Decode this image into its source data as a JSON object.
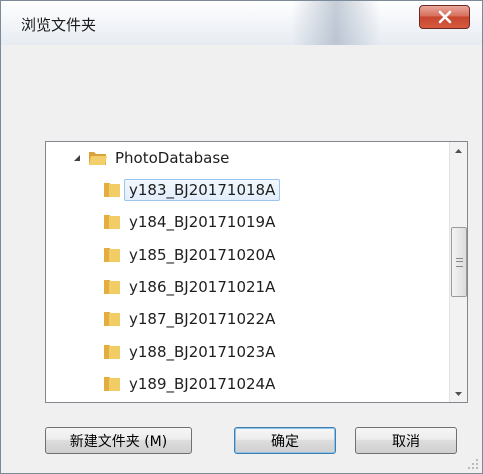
{
  "window": {
    "title": "浏览文件夹",
    "close_icon": "close-icon"
  },
  "tree": {
    "root": {
      "label": "PhotoDatabase",
      "expanded": true
    },
    "children": [
      {
        "label": "y183_BJ20171018A",
        "selected": true
      },
      {
        "label": "y184_BJ20171019A",
        "selected": false
      },
      {
        "label": "y185_BJ20171020A",
        "selected": false
      },
      {
        "label": "y186_BJ20171021A",
        "selected": false
      },
      {
        "label": "y187_BJ20171022A",
        "selected": false
      },
      {
        "label": "y188_BJ20171023A",
        "selected": false
      },
      {
        "label": "y189_BJ20171024A",
        "selected": false
      }
    ]
  },
  "buttons": {
    "new_folder": "新建文件夹 (M)",
    "ok": "确定",
    "cancel": "取消"
  },
  "colors": {
    "close_button": "#c7452f",
    "selection_border": "#99c4ee",
    "folder": "#e8b84a"
  }
}
